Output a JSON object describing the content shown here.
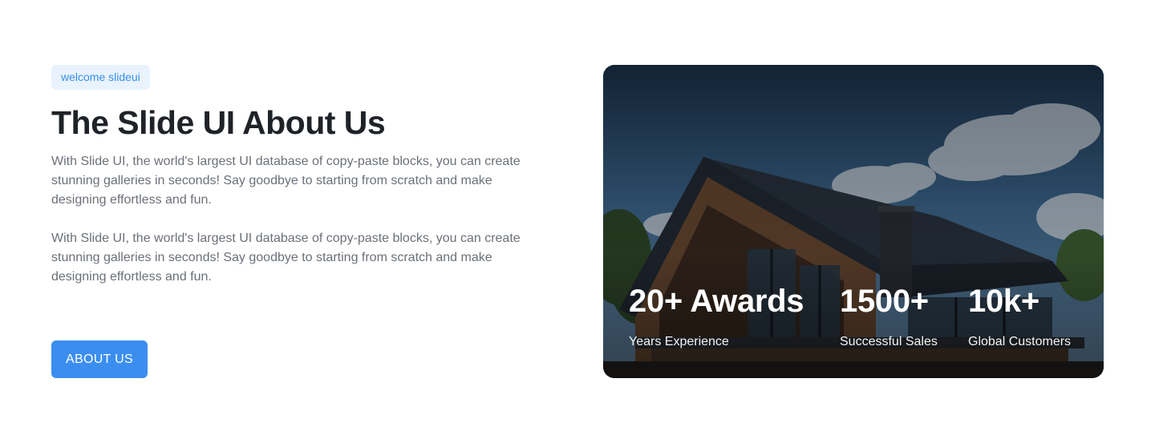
{
  "hero": {
    "badge": "welcome slideui",
    "title": "The Slide UI About Us",
    "paragraphs": [
      "With Slide UI, the world's largest UI database of copy-paste blocks, you can create stunning galleries in seconds! Say goodbye to starting from scratch and make designing effortless and fun.",
      "With Slide UI, the world's largest UI database of copy-paste blocks, you can create stunning galleries in seconds! Say goodbye to starting from scratch and make designing effortless and fun."
    ],
    "cta_label": "ABOUT US"
  },
  "card": {
    "image_icon": "modern-house-photo",
    "stats": [
      {
        "value": "20+ Awards",
        "label": "Years Experience"
      },
      {
        "value": "1500+",
        "label": "Successful Sales"
      },
      {
        "value": "10k+",
        "label": "Global Customers"
      }
    ]
  },
  "colors": {
    "accent": "#3b8ef0",
    "badge_bg": "#e8f3fe",
    "badge_text": "#3b8ee6",
    "title": "#1f2328",
    "body_text": "#6b7078"
  }
}
